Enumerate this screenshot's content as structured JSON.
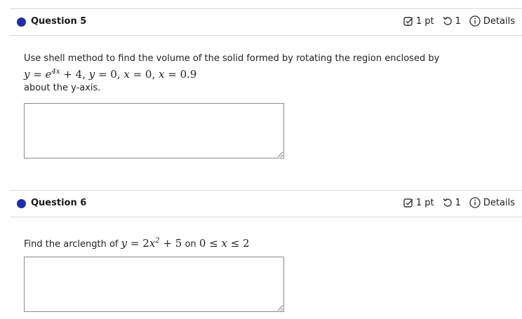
{
  "questions": [
    {
      "title": "Question 5",
      "points": "1 pt",
      "retries": "1",
      "details": "Details",
      "prompt_before": "Use shell method to find the volume of the solid formed by rotating the region enclosed by",
      "prompt_math": "y = e^{4x} + 4, y = 0, x = 0, x = 0.9",
      "prompt_after": "about the y-axis.",
      "answer_value": ""
    },
    {
      "title": "Question 6",
      "points": "1 pt",
      "retries": "1",
      "details": "Details",
      "prompt_before": "Find the arclength of",
      "prompt_math": "y = 2x^2 + 5",
      "prompt_mid": "on",
      "prompt_math2": "0 ≤ x ≤ 2",
      "answer_value": ""
    }
  ],
  "colors": {
    "bullet": "#1f2fa3",
    "rule": "#d6d6d6",
    "border": "#8a8a8a"
  },
  "icons": [
    "checkbox-pencil-icon",
    "retry-icon",
    "info-icon",
    "resize-grip-icon"
  ]
}
